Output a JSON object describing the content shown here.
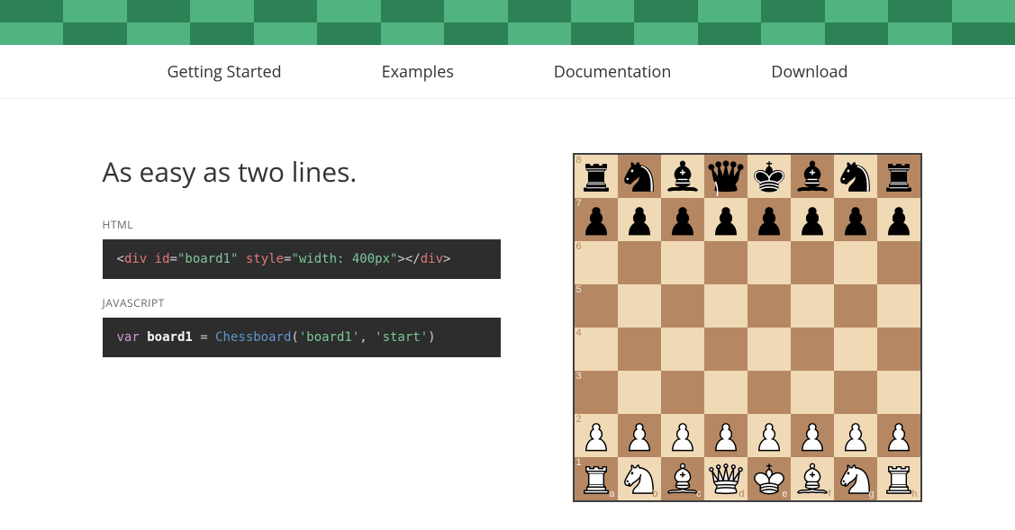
{
  "nav": {
    "items": [
      {
        "label": "Getting Started"
      },
      {
        "label": "Examples"
      },
      {
        "label": "Documentation"
      },
      {
        "label": "Download"
      }
    ]
  },
  "intro": {
    "headline": "As easy as two lines.",
    "html_label": "HTML",
    "html_code_tokens": [
      {
        "t": "<",
        "c": "punc"
      },
      {
        "t": "div",
        "c": "tag"
      },
      {
        "t": " id",
        "c": "attr"
      },
      {
        "t": "=",
        "c": "punc"
      },
      {
        "t": "\"board1\"",
        "c": "str"
      },
      {
        "t": " style",
        "c": "attr"
      },
      {
        "t": "=",
        "c": "punc"
      },
      {
        "t": "\"width: 400px\"",
        "c": "str"
      },
      {
        "t": ">",
        "c": "punc"
      },
      {
        "t": "<",
        "c": "punc"
      },
      {
        "t": "/",
        "c": "punc"
      },
      {
        "t": "div",
        "c": "tag"
      },
      {
        "t": ">",
        "c": "punc"
      }
    ],
    "js_label": "JAVASCRIPT",
    "js_code_tokens": [
      {
        "t": "var",
        "c": "kw"
      },
      {
        "t": " ",
        "c": "punc"
      },
      {
        "t": "board1",
        "c": "id"
      },
      {
        "t": " = ",
        "c": "punc"
      },
      {
        "t": "Chessboard",
        "c": "fn"
      },
      {
        "t": "(",
        "c": "punc"
      },
      {
        "t": "'board1'",
        "c": "str"
      },
      {
        "t": ", ",
        "c": "punc"
      },
      {
        "t": "'start'",
        "c": "str"
      },
      {
        "t": ")",
        "c": "punc"
      }
    ]
  },
  "board": {
    "ranks": [
      "8",
      "7",
      "6",
      "5",
      "4",
      "3",
      "2",
      "1"
    ],
    "files": [
      "a",
      "b",
      "c",
      "d",
      "e",
      "f",
      "g",
      "h"
    ],
    "position_fen": "rnbqkbnr/pppppppp/8/8/8/8/PPPPPPPP/RNBQKBNR"
  },
  "colors": {
    "banner_light": "#51b37f",
    "banner_dark": "#2c8255",
    "board_light": "#f0d9b5",
    "board_dark": "#b58863",
    "code_bg": "#2d2d2d"
  }
}
